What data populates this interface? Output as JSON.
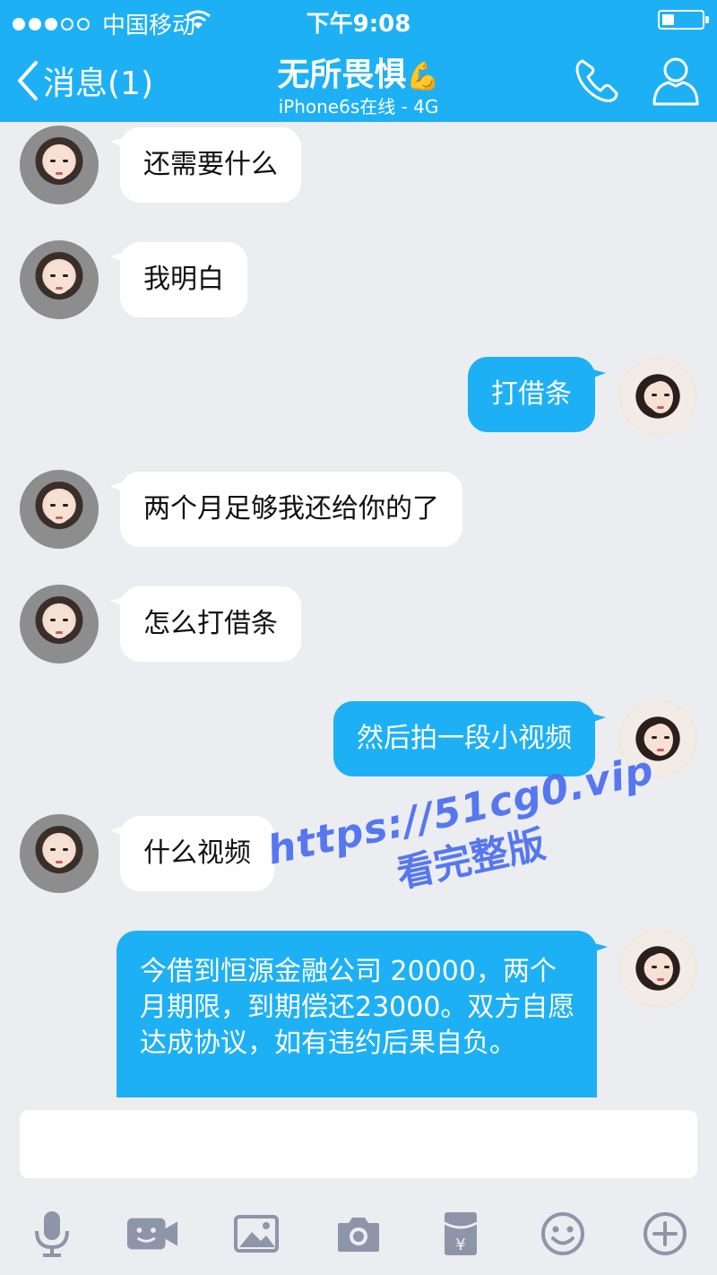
{
  "status_bar": {
    "carrier": "中国移动",
    "time": "下午9:08"
  },
  "header": {
    "back_label": "消息(1)",
    "title": "无所畏惧",
    "title_emoji": "💪",
    "subtitle": "iPhone6s在线 - 4G"
  },
  "messages": [
    {
      "side": "in",
      "text": "还需要什么"
    },
    {
      "side": "in",
      "text": "我明白"
    },
    {
      "side": "out",
      "text": "打借条"
    },
    {
      "side": "in",
      "text": "两个月足够我还给你的了"
    },
    {
      "side": "in",
      "text": "怎么打借条"
    },
    {
      "side": "out",
      "text": "然后拍一段小视频"
    },
    {
      "side": "in",
      "text": "什么视频"
    },
    {
      "side": "out",
      "text": "今借到恒源金融公司 20000，两个月期限，到期偿还23000。双方自愿达成协议，如有违约后果自负。"
    }
  ],
  "watermark": {
    "line1": "https://51cg0.vip",
    "line2": "看完整版"
  },
  "input": {
    "placeholder": ""
  },
  "toolbar": [
    "mic-icon",
    "video-icon",
    "image-icon",
    "camera-icon",
    "red-packet-icon",
    "emoji-icon",
    "plus-icon"
  ],
  "colors": {
    "header": "#1eb0f4",
    "outgoing_bubble": "#1eb0f4",
    "incoming_bubble": "#ffffff",
    "chat_background": "#ebedf1",
    "watermark": "#4a6df0",
    "toolbar_icon": "#8e95a8"
  }
}
